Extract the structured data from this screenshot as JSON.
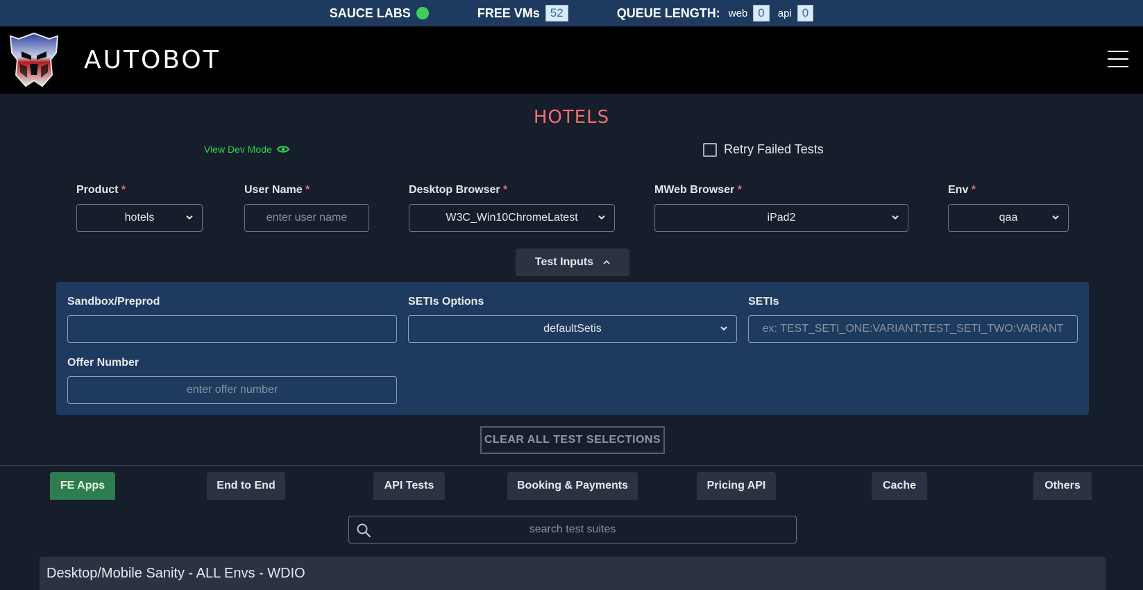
{
  "status": {
    "sauce_label": "SAUCE LABS",
    "sauce_color": "#3ecf5a",
    "free_vms_label": "FREE VMs",
    "free_vms_count": "52",
    "queue_label": "QUEUE LENGTH:",
    "web_label": "web",
    "web_count": "0",
    "api_label": "api",
    "api_count": "0"
  },
  "header": {
    "brand": "AUTOBOT"
  },
  "page": {
    "title": "HOTELS",
    "dev_mode_label": "View Dev Mode",
    "retry_label": "Retry Failed Tests"
  },
  "form": {
    "product_label": "Product",
    "product_value": "hotels",
    "username_label": "User Name",
    "username_placeholder": "enter user name",
    "desktop_label": "Desktop Browser",
    "desktop_value": "W3C_Win10ChromeLatest",
    "mweb_label": "MWeb Browser",
    "mweb_value": "iPad2",
    "env_label": "Env",
    "env_value": "qaa",
    "required_mark": "*"
  },
  "test_inputs": {
    "toggle_label": "Test Inputs",
    "sandbox_label": "Sandbox/Preprod",
    "setis_options_label": "SETIs Options",
    "setis_options_value": "defaultSetis",
    "setis_label": "SETIs",
    "setis_placeholder": "ex: TEST_SETI_ONE:VARIANT;TEST_SETI_TWO:VARIANT",
    "offer_label": "Offer Number",
    "offer_placeholder": "enter offer number"
  },
  "clear_label": "CLEAR ALL TEST SELECTIONS",
  "tabs": [
    "FE Apps",
    "End to End",
    "API Tests",
    "Booking & Payments",
    "Pricing API",
    "Cache",
    "Others"
  ],
  "search_placeholder": "search test suites",
  "suites": [
    "Desktop/Mobile Sanity - ALL Envs - WDIO"
  ],
  "colors": {
    "accent_title": "#f07070",
    "dev_mode": "#2fd650",
    "active_tab": "#2e7d4f"
  }
}
